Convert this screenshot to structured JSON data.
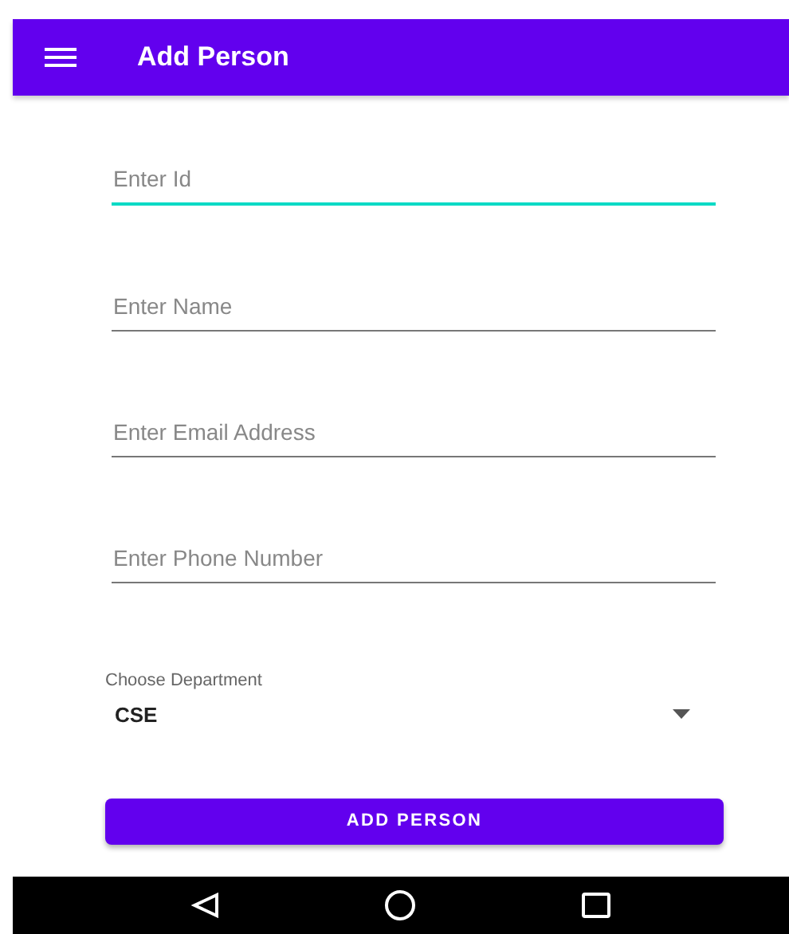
{
  "app_bar": {
    "title": "Add Person"
  },
  "fields": [
    {
      "placeholder": "Enter Id",
      "focused": true
    },
    {
      "placeholder": "Enter Name",
      "focused": false
    },
    {
      "placeholder": "Enter Email Address",
      "focused": false
    },
    {
      "placeholder": "Enter Phone Number",
      "focused": false
    }
  ],
  "department": {
    "label": "Choose Department",
    "value": "CSE"
  },
  "button": "ADD PERSON"
}
